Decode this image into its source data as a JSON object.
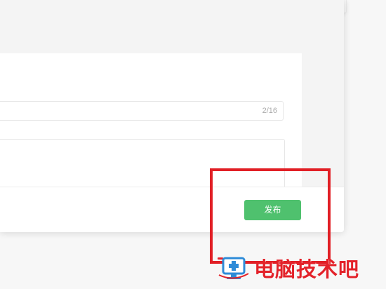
{
  "form": {
    "title_counter": "2/16",
    "title_value": "",
    "content_value": ""
  },
  "footer": {
    "publish_label": "发布"
  },
  "watermark": {
    "text": "电脑技术吧",
    "icon": "computer-monitor-icon"
  },
  "colors": {
    "publish_button": "#4fc16e",
    "highlight_box": "#e11f25",
    "watermark_text": "#e3222a",
    "watermark_icon_blue": "#2e8bd8"
  }
}
